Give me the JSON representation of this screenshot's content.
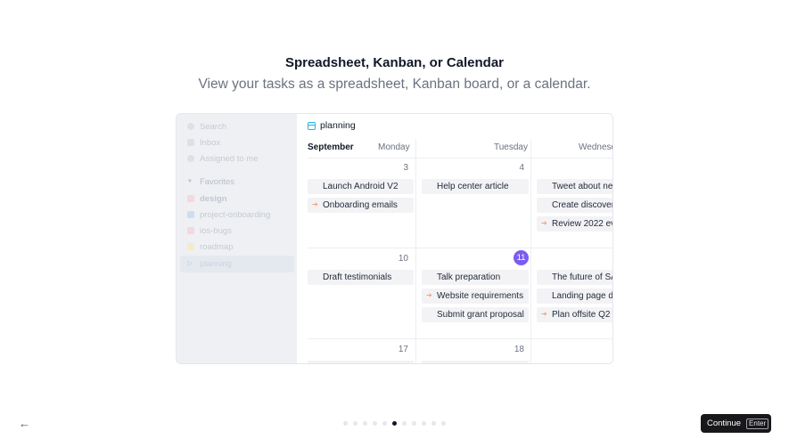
{
  "header": {
    "title": "Spreadsheet, Kanban, or Calendar",
    "subtitle": "View your tasks as a spreadsheet, Kanban board, or a calendar."
  },
  "sidebar": {
    "search": "Search",
    "inbox": "Inbox",
    "assigned": "Assigned to me",
    "favorites_label": "Favorites",
    "items": [
      "design",
      "project-onboarding",
      "ios-bugs",
      "roadmap",
      "planning"
    ]
  },
  "calendar": {
    "project": "planning",
    "month": "September",
    "days": [
      "Monday",
      "Tuesday",
      "Wednesd"
    ],
    "week1": {
      "nums": [
        "3",
        "4"
      ],
      "monday": [
        "Launch Android V2",
        "Onboarding emails"
      ],
      "tuesday": [
        "Help center article"
      ],
      "wednesday": [
        "Tweet about new",
        "Create discover",
        "Review 2022 ev"
      ]
    },
    "week2": {
      "nums": [
        "10",
        "11"
      ],
      "monday": [
        "Draft testimonials"
      ],
      "tuesday": [
        "Talk preparation",
        "Website requirements",
        "Submit grant proposal"
      ],
      "wednesday": [
        "The future of SA",
        "Landing page de",
        "Plan offsite Q2"
      ]
    },
    "week3": {
      "nums": [
        "17",
        "18"
      ]
    }
  },
  "footer": {
    "continue_label": "Continue",
    "continue_key": "Enter",
    "page_count": 11,
    "current_page": 6
  },
  "colors": {
    "accent_today": "#7c5cf0",
    "calendar_icon": "#1fb5e0",
    "in_progress_icon": "#f59e6b"
  }
}
